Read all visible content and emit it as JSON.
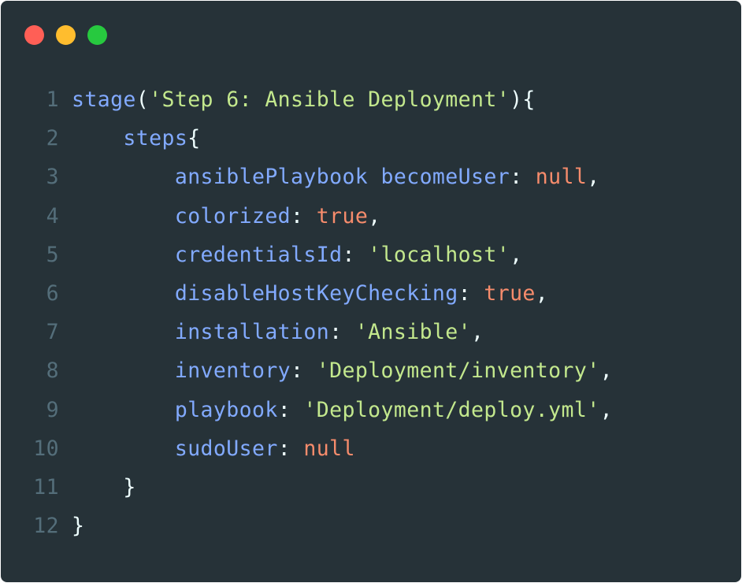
{
  "window": {
    "background": "#263238",
    "buttons": [
      {
        "name": "close",
        "color": "#ff5f56"
      },
      {
        "name": "minimize",
        "color": "#ffbd2e"
      },
      {
        "name": "zoom",
        "color": "#27c93f"
      }
    ]
  },
  "colors": {
    "line_number": "#546e7a",
    "identifier": "#82aaff",
    "string": "#c3e88d",
    "literal": "#f78c6c",
    "punctuation": "#eeffff"
  },
  "code": {
    "lines": [
      {
        "number": "1",
        "tokens": [
          {
            "t": "fn",
            "v": "stage"
          },
          {
            "t": "p",
            "v": "("
          },
          {
            "t": "str",
            "v": "'Step 6: Ansible Deployment'"
          },
          {
            "t": "p",
            "v": "){"
          }
        ]
      },
      {
        "number": "2",
        "tokens": [
          {
            "t": "ws",
            "v": "    "
          },
          {
            "t": "fn",
            "v": "steps"
          },
          {
            "t": "p",
            "v": "{"
          }
        ]
      },
      {
        "number": "3",
        "tokens": [
          {
            "t": "ws",
            "v": "        "
          },
          {
            "t": "fn",
            "v": "ansiblePlaybook becomeUser"
          },
          {
            "t": "p",
            "v": ": "
          },
          {
            "t": "kw",
            "v": "null"
          },
          {
            "t": "p",
            "v": ","
          }
        ]
      },
      {
        "number": "4",
        "tokens": [
          {
            "t": "ws",
            "v": "        "
          },
          {
            "t": "fn",
            "v": "colorized"
          },
          {
            "t": "p",
            "v": ": "
          },
          {
            "t": "kw",
            "v": "true"
          },
          {
            "t": "p",
            "v": ","
          }
        ]
      },
      {
        "number": "5",
        "tokens": [
          {
            "t": "ws",
            "v": "        "
          },
          {
            "t": "fn",
            "v": "credentialsId"
          },
          {
            "t": "p",
            "v": ": "
          },
          {
            "t": "str",
            "v": "'localhost'"
          },
          {
            "t": "p",
            "v": ","
          }
        ]
      },
      {
        "number": "6",
        "tokens": [
          {
            "t": "ws",
            "v": "        "
          },
          {
            "t": "fn",
            "v": "disableHostKeyChecking"
          },
          {
            "t": "p",
            "v": ": "
          },
          {
            "t": "kw",
            "v": "true"
          },
          {
            "t": "p",
            "v": ","
          }
        ]
      },
      {
        "number": "7",
        "tokens": [
          {
            "t": "ws",
            "v": "        "
          },
          {
            "t": "fn",
            "v": "installation"
          },
          {
            "t": "p",
            "v": ": "
          },
          {
            "t": "str",
            "v": "'Ansible'"
          },
          {
            "t": "p",
            "v": ","
          }
        ]
      },
      {
        "number": "8",
        "tokens": [
          {
            "t": "ws",
            "v": "        "
          },
          {
            "t": "fn",
            "v": "inventory"
          },
          {
            "t": "p",
            "v": ": "
          },
          {
            "t": "str",
            "v": "'Deployment/inventory'"
          },
          {
            "t": "p",
            "v": ","
          }
        ]
      },
      {
        "number": "9",
        "tokens": [
          {
            "t": "ws",
            "v": "        "
          },
          {
            "t": "fn",
            "v": "playbook"
          },
          {
            "t": "p",
            "v": ": "
          },
          {
            "t": "str",
            "v": "'Deployment/deploy.yml'"
          },
          {
            "t": "p",
            "v": ","
          }
        ]
      },
      {
        "number": "10",
        "tokens": [
          {
            "t": "ws",
            "v": "        "
          },
          {
            "t": "fn",
            "v": "sudoUser"
          },
          {
            "t": "p",
            "v": ": "
          },
          {
            "t": "kw",
            "v": "null"
          }
        ]
      },
      {
        "number": "11",
        "tokens": [
          {
            "t": "ws",
            "v": "    "
          },
          {
            "t": "p",
            "v": "}"
          }
        ]
      },
      {
        "number": "12",
        "tokens": [
          {
            "t": "p",
            "v": "}"
          }
        ]
      }
    ]
  }
}
